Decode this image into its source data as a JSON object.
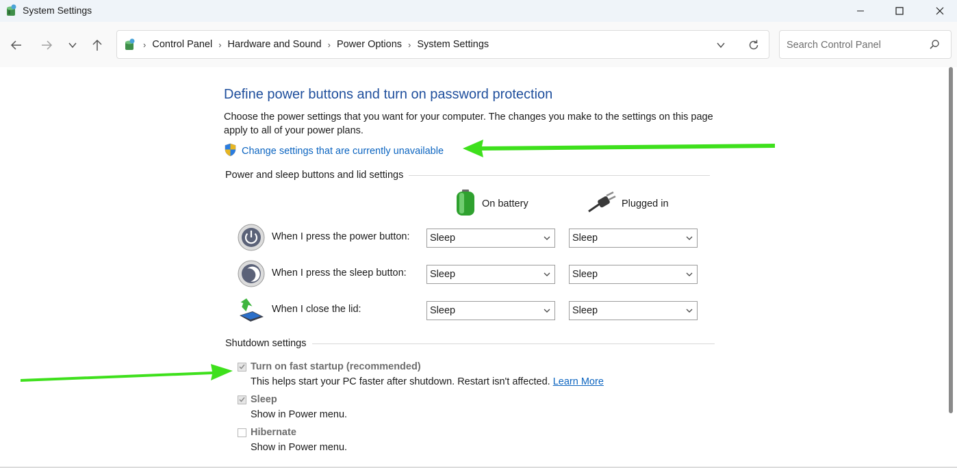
{
  "window": {
    "title": "System Settings"
  },
  "address_bar": {
    "breadcrumbs": [
      "Control Panel",
      "Hardware and Sound",
      "Power Options",
      "System Settings"
    ]
  },
  "search": {
    "placeholder": "Search Control Panel"
  },
  "main": {
    "title": "Define power buttons and turn on password protection",
    "description": "Choose the power settings that you want for your computer. The changes you make to the settings on this page apply to all of your power plans.",
    "change_link": "Change settings that are currently unavailable"
  },
  "power_section": {
    "heading": "Power and sleep buttons and lid settings",
    "col_battery": "On battery",
    "col_plugged": "Plugged in",
    "rows": [
      {
        "label": "When I press the power button:",
        "battery": "Sleep",
        "plugged": "Sleep",
        "icon": "power-button-icon"
      },
      {
        "label": "When I press the sleep button:",
        "battery": "Sleep",
        "plugged": "Sleep",
        "icon": "sleep-button-icon"
      },
      {
        "label": "When I close the lid:",
        "battery": "Sleep",
        "plugged": "Sleep",
        "icon": "laptop-lid-icon"
      }
    ]
  },
  "shutdown_section": {
    "heading": "Shutdown settings",
    "options": [
      {
        "label": "Turn on fast startup (recommended)",
        "checked": true,
        "desc": "This helps start your PC faster after shutdown. Restart isn't affected.",
        "link": "Learn More"
      },
      {
        "label": "Sleep",
        "checked": true,
        "desc": "Show in Power menu."
      },
      {
        "label": "Hibernate",
        "checked": false,
        "desc": "Show in Power menu."
      }
    ]
  },
  "colors": {
    "title_blue": "#1e4e9c",
    "link_blue": "#0b64c0",
    "annotation_green": "#3ee01c"
  }
}
